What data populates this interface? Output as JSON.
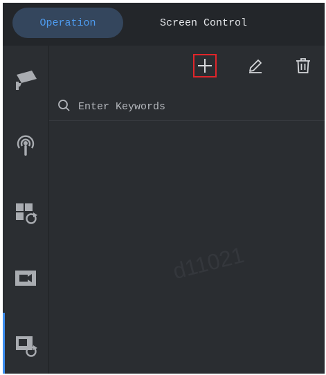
{
  "tabs": [
    {
      "label": "Operation",
      "active": true
    },
    {
      "label": "Screen Control",
      "active": false
    }
  ],
  "sidebar": {
    "items": [
      {
        "icon": "camera-icon",
        "selected": false
      },
      {
        "icon": "broadcast-icon",
        "selected": false
      },
      {
        "icon": "layout-refresh-icon",
        "selected": false
      },
      {
        "icon": "video-icon",
        "selected": false
      },
      {
        "icon": "screen-refresh-icon",
        "selected": true
      }
    ]
  },
  "toolbar": {
    "add_icon": "plus-icon",
    "edit_icon": "pencil-icon",
    "delete_icon": "trash-icon"
  },
  "search": {
    "placeholder": "Enter Keywords",
    "value": ""
  },
  "watermark": "d11021",
  "colors": {
    "accent": "#4e9cf0",
    "highlight": "#e0252a",
    "background": "#2a2d31"
  }
}
